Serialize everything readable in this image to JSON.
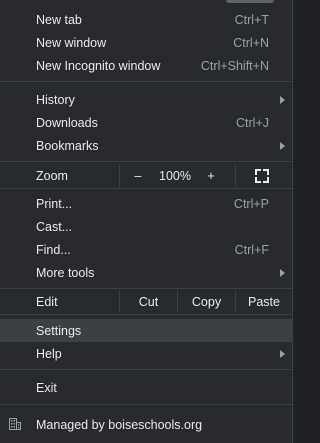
{
  "menu": {
    "new_tab": {
      "label": "New tab",
      "shortcut": "Ctrl+T"
    },
    "new_window": {
      "label": "New window",
      "shortcut": "Ctrl+N"
    },
    "new_incognito": {
      "label": "New Incognito window",
      "shortcut": "Ctrl+Shift+N"
    },
    "history": {
      "label": "History"
    },
    "downloads": {
      "label": "Downloads",
      "shortcut": "Ctrl+J"
    },
    "bookmarks": {
      "label": "Bookmarks"
    },
    "zoom": {
      "label": "Zoom",
      "minus": "–",
      "level": "100%",
      "plus": "+"
    },
    "print": {
      "label": "Print...",
      "shortcut": "Ctrl+P"
    },
    "cast": {
      "label": "Cast..."
    },
    "find": {
      "label": "Find...",
      "shortcut": "Ctrl+F"
    },
    "more_tools": {
      "label": "More tools"
    },
    "edit": {
      "label": "Edit",
      "cut": "Cut",
      "copy": "Copy",
      "paste": "Paste"
    },
    "settings": {
      "label": "Settings"
    },
    "help": {
      "label": "Help"
    },
    "exit": {
      "label": "Exit"
    },
    "managed": {
      "label": "Managed by boiseschools.org",
      "icon": "building-icon"
    }
  },
  "colors": {
    "background": "#292a2d",
    "hover": "#3c4043",
    "text": "#e8eaed",
    "shortcut": "#9aa0a6"
  }
}
